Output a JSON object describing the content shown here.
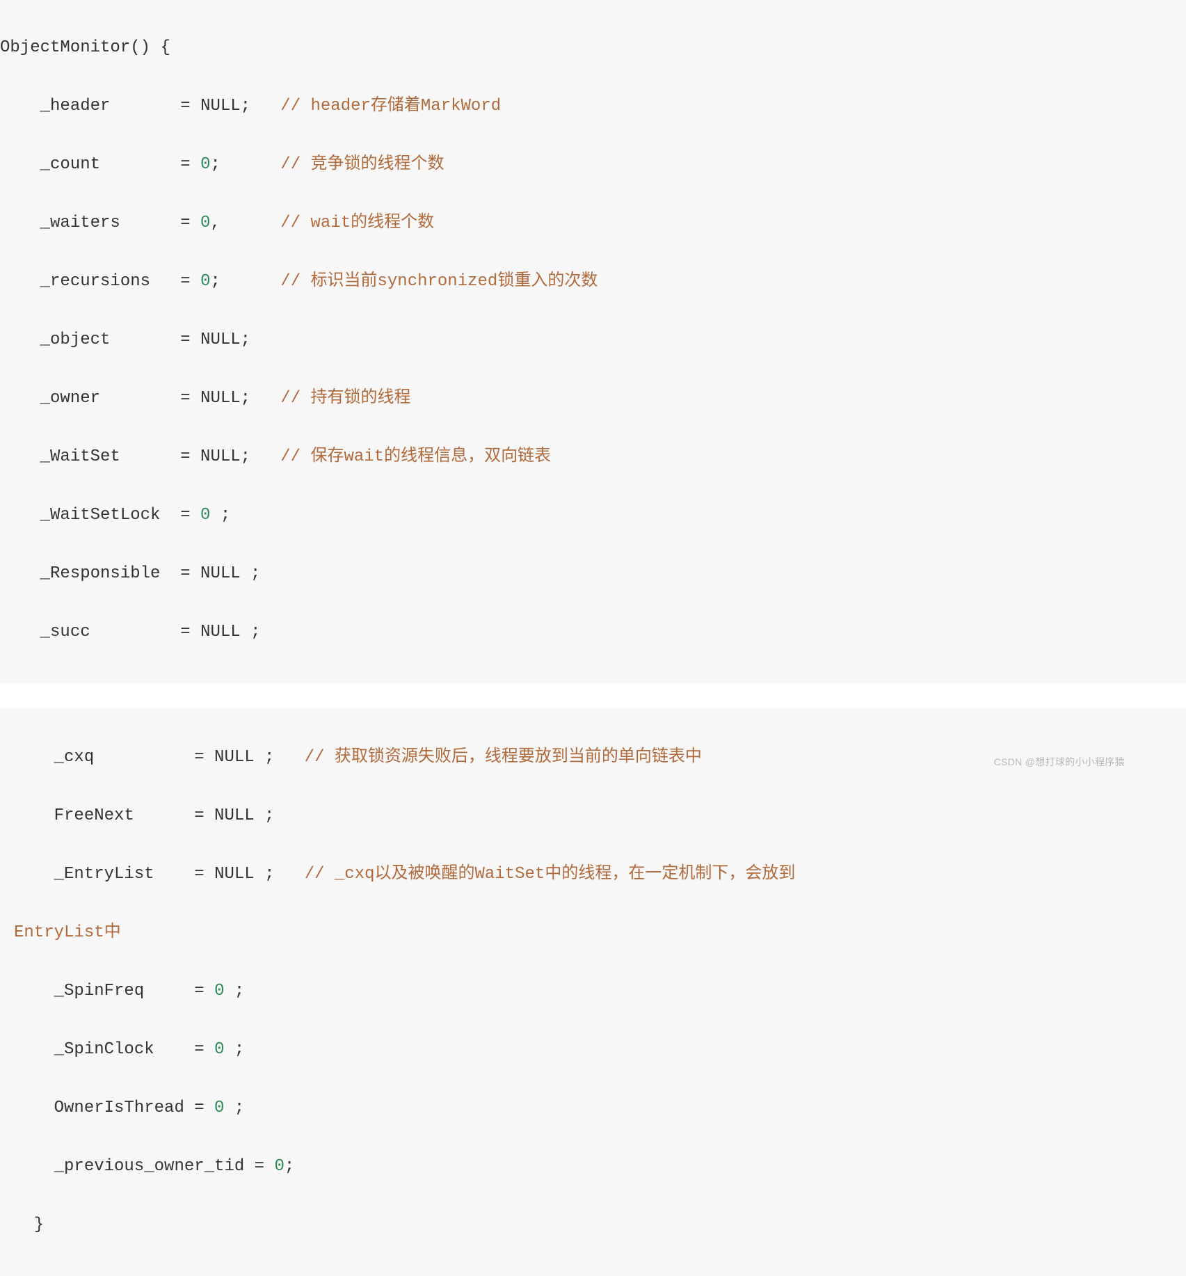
{
  "block1": {
    "l0": "ObjectMonitor() {",
    "l1_name": "    _header",
    "l1_eq": "       = ",
    "l1_val": "NULL;",
    "l1_comment": "   // header存储着MarkWord",
    "l2_name": "    _count",
    "l2_eq": "        = ",
    "l2_val": "0",
    "l2_semi": ";",
    "l2_comment": "      // 竞争锁的线程个数",
    "l3_name": "    _waiters",
    "l3_eq": "      = ",
    "l3_val": "0",
    "l3_semi": ",",
    "l3_comment": "      // wait的线程个数",
    "l4_name": "    _recursions",
    "l4_eq": "   = ",
    "l4_val": "0",
    "l4_semi": ";",
    "l4_comment": "      // 标识当前synchronized锁重入的次数",
    "l5_name": "    _object",
    "l5_eq": "       = ",
    "l5_val": "NULL;",
    "l6_name": "    _owner",
    "l6_eq": "        = ",
    "l6_val": "NULL;",
    "l6_comment": "   // 持有锁的线程",
    "l7_name": "    _WaitSet",
    "l7_eq": "      = ",
    "l7_val": "NULL;",
    "l7_comment": "   // 保存wait的线程信息，双向链表",
    "l8_name": "    _WaitSetLock",
    "l8_eq": "  = ",
    "l8_val": "0",
    "l8_semi": " ;",
    "l9_name": "    _Responsible",
    "l9_eq": "  = ",
    "l9_val": "NULL ;",
    "l10_name": "    _succ",
    "l10_eq": "         = ",
    "l10_val": "NULL ;"
  },
  "block2": {
    "l1_name": "    _cxq",
    "l1_eq": "          = ",
    "l1_val": "NULL ;",
    "l1_comment": "   // 获取锁资源失败后，线程要放到当前的单向链表中",
    "l2_name": "    FreeNext",
    "l2_eq": "      = ",
    "l2_val": "NULL ;",
    "l3_name": "    _EntryList",
    "l3_eq": "    = ",
    "l3_val": "NULL ;",
    "l3_comment": "   // _cxq以及被唤醒的WaitSet中的线程，在一定机制下，会放到",
    "l3b": "EntryList中",
    "l4_name": "    _SpinFreq",
    "l4_eq": "     = ",
    "l4_val": "0",
    "l4_semi": " ;",
    "l5_name": "    _SpinClock",
    "l5_eq": "    = ",
    "l5_val": "0",
    "l5_semi": " ;",
    "l6_name": "    OwnerIsThread = ",
    "l6_val": "0",
    "l6_semi": " ;",
    "l7_name": "    _previous_owner_tid = ",
    "l7_val": "0",
    "l7_semi": ";",
    "l8": "  }"
  },
  "watermark": "CSDN @想打球的小小程序猿"
}
